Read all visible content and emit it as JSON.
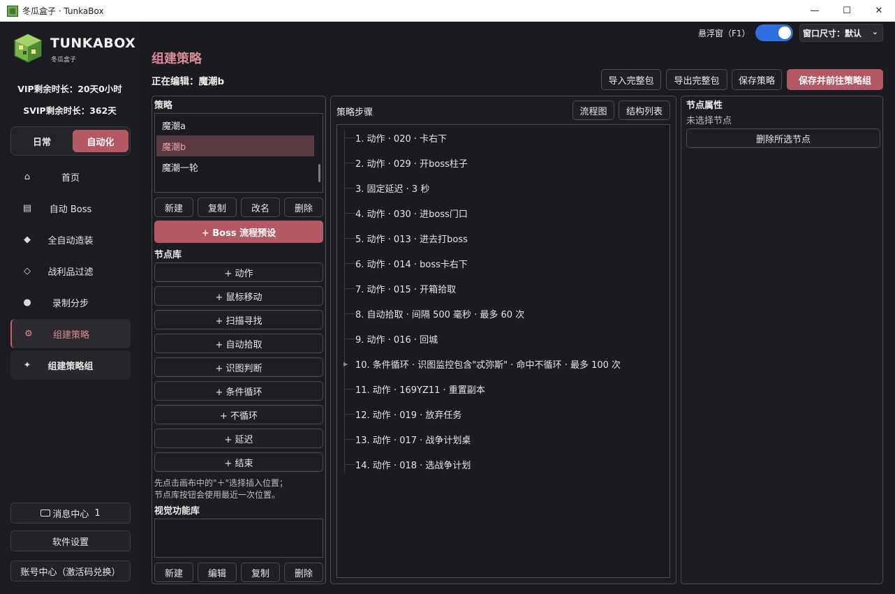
{
  "window": {
    "title": "冬瓜盒子 · TunkaBox",
    "minimize": "—",
    "maximize": "☐",
    "close": "✕"
  },
  "sidebar": {
    "brand": "TUNKABOX",
    "brand_sub": "冬瓜盒子",
    "vip": "VIP剩余时长：20天0小时",
    "svip": "SVIP剩余时长：362天",
    "mode": {
      "daily": "日常",
      "auto": "自动化"
    },
    "nav": [
      {
        "icon": "⌂",
        "label": "首页"
      },
      {
        "icon": "▤",
        "label": "自动 Boss"
      },
      {
        "icon": "◆",
        "label": "全自动造装"
      },
      {
        "icon": "◇",
        "label": "战利品过滤"
      },
      {
        "icon": "●",
        "label": "录制分步"
      },
      {
        "icon": "⚙",
        "label": "组建策略"
      },
      {
        "icon": "✦",
        "label": "组建策略组"
      }
    ],
    "messages": "消息中心",
    "messages_count": "1",
    "settings": "软件设置",
    "account": "账号中心（激活码兑换）"
  },
  "header": {
    "title": "组建策略",
    "editing": "正在编辑：魔潮b",
    "float_label": "悬浮窗（F1）",
    "float_on": true,
    "win_size": "窗口尺寸：默认",
    "import": "导入完整包",
    "export": "导出完整包",
    "save": "保存策略",
    "save_go": "保存并前往策略组"
  },
  "strategy_panel": {
    "label": "策略",
    "items": [
      "魔潮a",
      "魔潮b",
      "魔潮一轮"
    ],
    "selected": "魔潮b",
    "btn_new": "新建",
    "btn_copy": "复制",
    "btn_rename": "改名",
    "btn_delete": "删除",
    "boss_preset": "+  Boss 流程预设",
    "node_lib_label": "节点库",
    "nodes": [
      "+  动作",
      "+  鼠标移动",
      "+  扫描寻找",
      "+  自动拾取",
      "+  识图判断",
      "+  条件循环",
      "+  不循环",
      "+  延迟",
      "+  结束"
    ],
    "hint1": "先点击画布中的\"＋\"选择插入位置；",
    "hint2": "节点库按钮会使用最近一次位置。",
    "vision_label": "视觉功能库",
    "vbtn_new": "新建",
    "vbtn_edit": "编辑",
    "vbtn_copy": "复制",
    "vbtn_delete": "删除"
  },
  "steps_panel": {
    "label": "策略步骤",
    "flow_btn": "流程图",
    "struct_btn": "结构列表",
    "steps": [
      "1. 动作 · 020 · 卡右下",
      "2. 动作 · 029 · 开boss柱子",
      "3. 固定延迟 · 3 秒",
      "4. 动作 · 030 · 进boss门口",
      "5. 动作 · 013 · 进去打boss",
      "6. 动作 · 014 · boss卡右下",
      "7. 动作 · 015 · 开箱拾取",
      "8. 自动拾取 · 间隔 500 毫秒 · 最多 60 次",
      "9. 动作 · 016 · 回城",
      "10. 条件循环 · 识图监控包含\"忒弥斯\" · 命中不循环 · 最多 100 次",
      "11. 动作 · 169YZ11 · 重置副本",
      "12. 动作 · 019 · 放弃任务",
      "13. 动作 · 017 · 战争计划桌",
      "14. 动作 · 018 · 选战争计划"
    ]
  },
  "props_panel": {
    "label": "节点属性",
    "none_selected": "未选择节点",
    "delete_selected": "删除所选节点"
  },
  "colors": {
    "accent": "#b45864",
    "accent_text": "#d98c96",
    "toggle": "#2f6fe0"
  }
}
